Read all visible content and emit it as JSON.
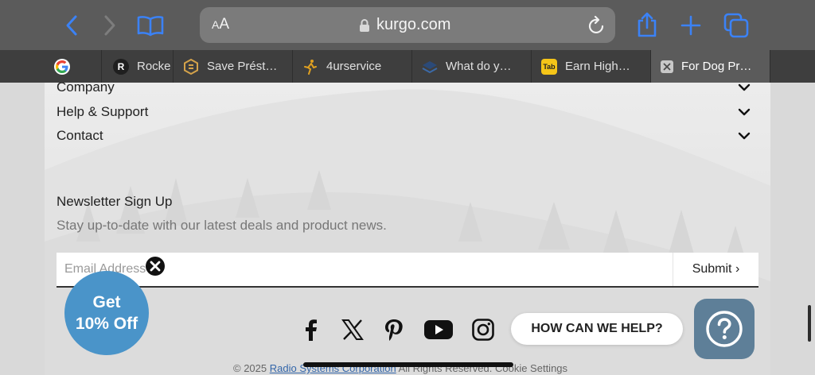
{
  "browser": {
    "reader_label_small": "A",
    "reader_label_large": "A",
    "url": "kurgo.com",
    "icons": {
      "back": "chevron-left-icon",
      "forward": "chevron-right-icon",
      "bookmarks": "book-icon",
      "lock": "lock-icon",
      "reload": "reload-icon",
      "share": "share-icon",
      "new_tab": "plus-icon",
      "tabs": "tabs-overview-icon"
    },
    "tabs": [
      {
        "label": "",
        "icon": "google-icon"
      },
      {
        "label": "Rocke",
        "icon": "r-icon"
      },
      {
        "label": "Save Prést…",
        "icon": "save-icon"
      },
      {
        "label": "4urservice",
        "icon": "runner-icon"
      },
      {
        "label": "What do y…",
        "icon": "layers-icon"
      },
      {
        "label": "Earn High…",
        "icon": "tab-icon"
      },
      {
        "label": "For Dog Pr…",
        "icon": "close-icon",
        "active": true
      }
    ]
  },
  "footer": {
    "sections": [
      {
        "label": "Company"
      },
      {
        "label": "Help & Support"
      },
      {
        "label": "Contact"
      }
    ],
    "newsletter": {
      "title": "Newsletter Sign Up",
      "description": "Stay up-to-date with our latest deals and product news.",
      "email_placeholder": "Email Address",
      "submit_label": "Submit ›"
    },
    "social_icons": [
      "facebook-icon",
      "x-twitter-icon",
      "pinterest-icon",
      "youtube-icon",
      "instagram-icon"
    ],
    "copyright": {
      "prefix": "© 2025 ",
      "link": "Radio Systems Corporation",
      "suffix": " All Rights Reserved. Cookie Settings"
    }
  },
  "promo": {
    "line1": "Get",
    "line2": "10% Off"
  },
  "help": {
    "label": "HOW CAN WE HELP?",
    "icon": "question-icon"
  },
  "colors": {
    "accent_blue": "#4a94c9",
    "help_button": "#5e7f98",
    "toolbar": "#5b5b5b",
    "tabbar": "#3e3e3e",
    "browser_icon_blue": "#3b82f6"
  }
}
